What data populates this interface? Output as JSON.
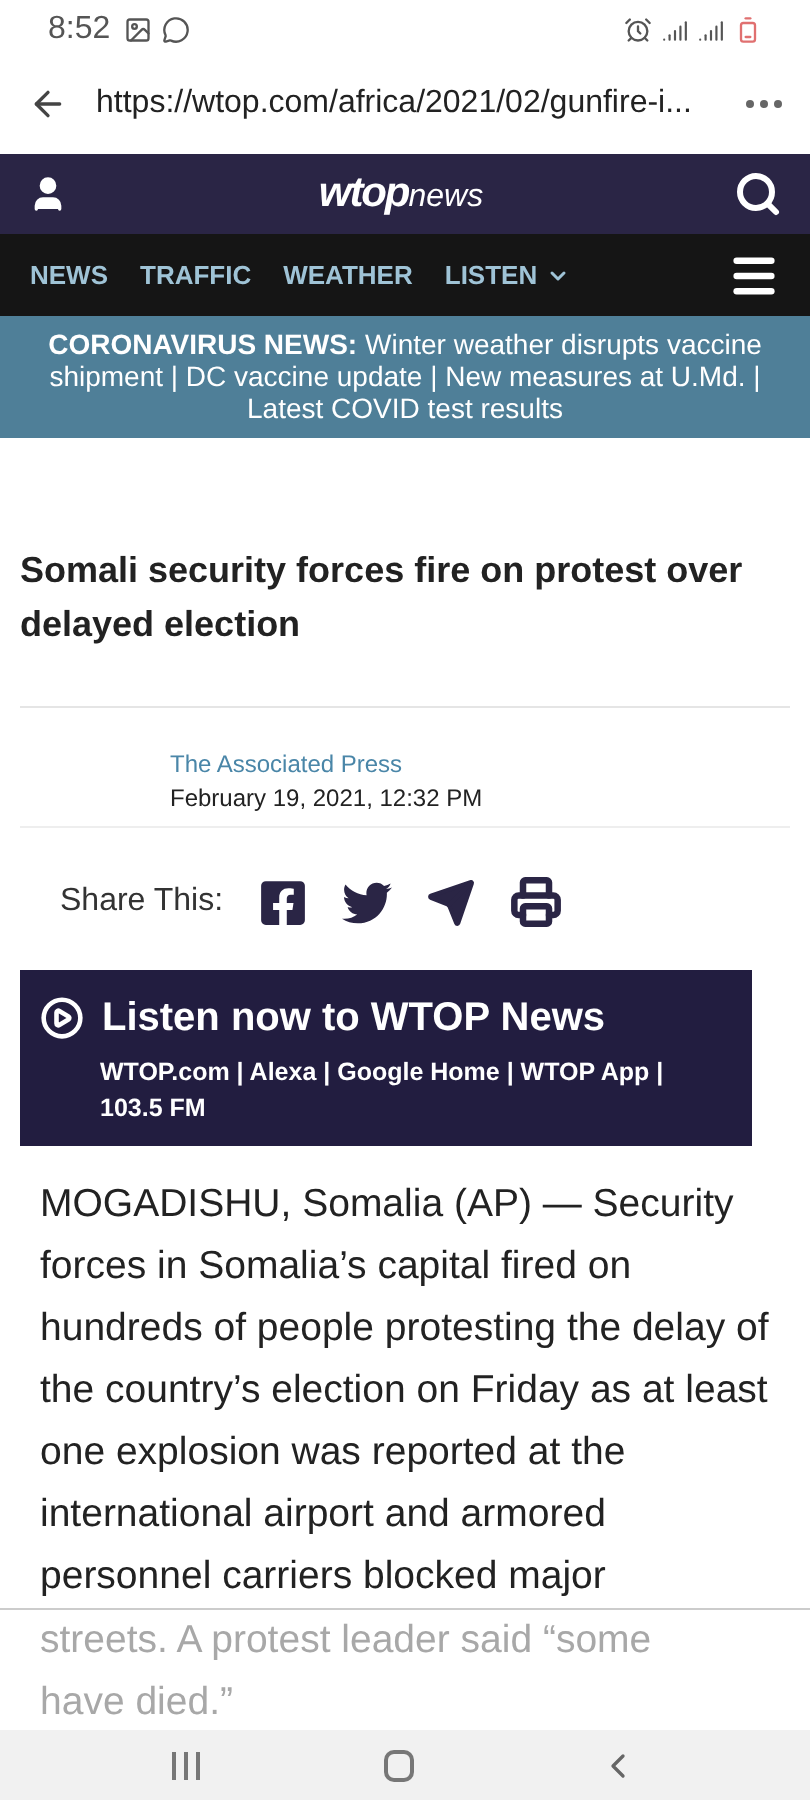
{
  "status_bar": {
    "time": "8:52"
  },
  "browser": {
    "url": "https://wtop.com/africa/2021/02/gunfire-i..."
  },
  "site_header": {
    "logo_bold": "wtop",
    "logo_light": "news"
  },
  "nav": [
    {
      "label": "NEWS"
    },
    {
      "label": "TRAFFIC"
    },
    {
      "label": "WEATHER"
    },
    {
      "label": "LISTEN",
      "dropdown": true
    }
  ],
  "banner": {
    "text": "**CORONAVIRUS NEWS:** Winter weather disrupts vaccine shipment | DC vaccine update | New measures at U.Md. | Latest COVID test results"
  },
  "article": {
    "title": "Somali security forces fire on protest over delayed election",
    "author": "The Associated Press",
    "date": "February 19, 2021, 12:32 PM",
    "share_label": "Share This:",
    "body": "MOGADISHU, Somalia (AP) — Security forces in Somalia’s capital fired on hundreds of people protesting the delay of the country’s election on Friday as at least one explosion was reported at the international airport and armored personnel carriers blocked major",
    "faded_text": "streets. A protest leader said “some have died.”"
  },
  "listen_box": {
    "title": "Listen now to WTOP News",
    "links": "WTOP.com | Alexa | Google Home | WTOP App | 103.5 FM"
  }
}
